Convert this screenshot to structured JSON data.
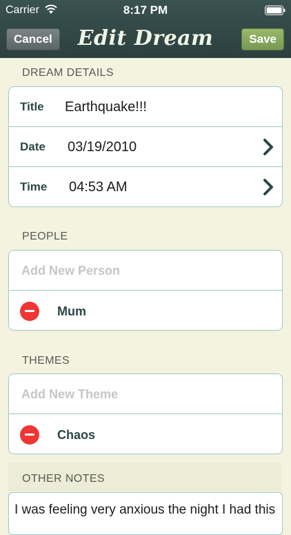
{
  "status_bar": {
    "carrier": "Carrier",
    "time": "8:17 PM",
    "icons": [
      "wifi-icon",
      "battery-icon"
    ]
  },
  "nav": {
    "title": "Edit Dream",
    "cancel_label": "Cancel",
    "save_label": "Save",
    "colors": {
      "bar": "#2c403f",
      "save": "#8aab60",
      "cancel": "#6b7475"
    }
  },
  "dream_details": {
    "header": "DREAM DETAILS",
    "title_label": "Title",
    "title_value": "Earthquake!!!",
    "date_label": "Date",
    "date_value": "03/19/2010",
    "time_label": "Time",
    "time_value": "04:53 AM"
  },
  "people": {
    "header": "PEOPLE",
    "placeholder": "Add New Person",
    "items": [
      "Mum"
    ]
  },
  "themes": {
    "header": "THEMES",
    "placeholder": "Add New Theme",
    "items": [
      "Chaos"
    ]
  },
  "notes": {
    "header": "OTHER NOTES",
    "text": "I was feeling very anxious the night I had this"
  },
  "colors": {
    "background": "#f3f3e0",
    "border": "#9cc9c3",
    "delete": "#f03535",
    "label": "#2b4746"
  }
}
